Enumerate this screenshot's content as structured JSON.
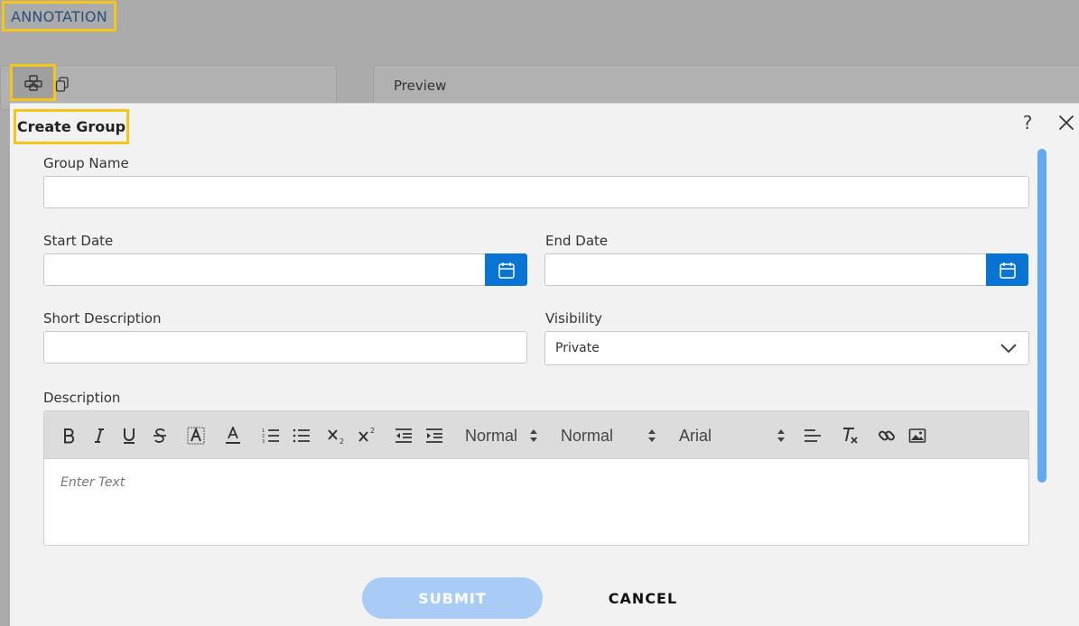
{
  "page": {
    "title": "ANNOTATION",
    "preview_tab": "Preview"
  },
  "modal": {
    "title": "Create Group",
    "help_label": "?",
    "fields": {
      "group_name_label": "Group Name",
      "group_name_value": "",
      "start_date_label": "Start Date",
      "start_date_value": "",
      "end_date_label": "End Date",
      "end_date_value": "",
      "short_description_label": "Short Description",
      "short_description_value": "",
      "visibility_label": "Visibility",
      "visibility_value": "Private",
      "description_label": "Description"
    },
    "editor": {
      "header_size": "Normal",
      "font_size": "Normal",
      "font_family": "Arial",
      "placeholder": "Enter Text"
    },
    "buttons": {
      "submit": "SUBMIT",
      "cancel": "CANCEL"
    }
  },
  "colors": {
    "highlight": "#f5c518",
    "primary": "#0a74d4",
    "submit_disabled": "#a8ccf6",
    "scrollbar": "#61a9f3"
  }
}
